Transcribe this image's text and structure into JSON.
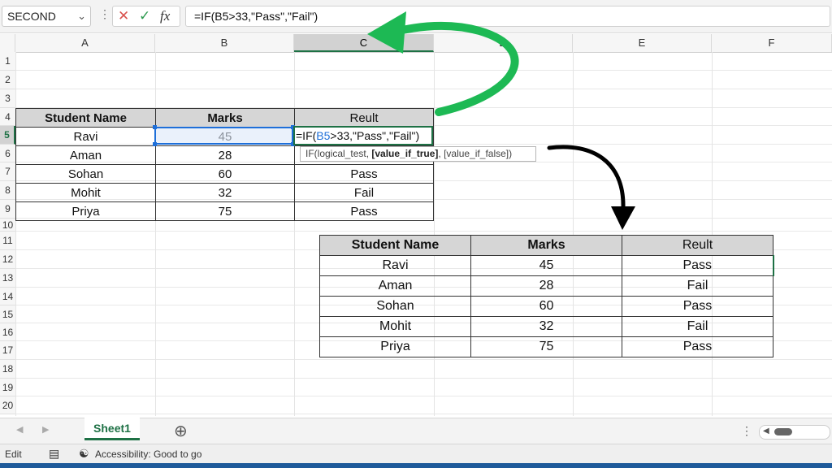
{
  "formula_bar": {
    "name_box": "SECOND",
    "dropdown_icon": "chevron-down-icon",
    "more_icon": "vertical-dots-icon",
    "cancel_icon": "✕",
    "enter_icon": "✓",
    "function_icon": "fx",
    "formula": "=IF(B5>33,\"Pass\",\"Fail\")"
  },
  "columns": [
    "A",
    "B",
    "C",
    "D",
    "E",
    "F"
  ],
  "rows": [
    "1",
    "2",
    "3",
    "4",
    "5",
    "6",
    "7",
    "8",
    "9",
    "10",
    "11",
    "12",
    "13",
    "14",
    "15",
    "16",
    "17",
    "18",
    "19",
    "20"
  ],
  "active_cell": {
    "edit_prefix": "=IF(",
    "edit_ref": "B5",
    "edit_suffix": ">33,\"Pass\",\"Fail\")"
  },
  "tooltip": {
    "open": "IF(logical_test, ",
    "bold": "[value_if_true]",
    "rest": ", [value_if_false])"
  },
  "table1": {
    "headers": [
      "Student Name",
      "Marks",
      "Reult"
    ],
    "rows": [
      [
        "Ravi",
        "45",
        ""
      ],
      [
        "Aman",
        "28",
        ""
      ],
      [
        "Sohan",
        "60",
        "Pass"
      ],
      [
        "Mohit",
        "32",
        "Fail"
      ],
      [
        "Priya",
        "75",
        "Pass"
      ]
    ]
  },
  "table2": {
    "headers": [
      "Student Name",
      "Marks",
      "Reult"
    ],
    "rows": [
      [
        "Ravi",
        "45",
        "Pass"
      ],
      [
        "Aman",
        "28",
        "Fail"
      ],
      [
        "Sohan",
        "60",
        "Pass"
      ],
      [
        "Mohit",
        "32",
        "Fail"
      ],
      [
        "Priya",
        "75",
        "Pass"
      ]
    ]
  },
  "sheet_tabs": {
    "active": "Sheet1",
    "add_icon": "plus-circle-icon"
  },
  "status_bar": {
    "mode": "Edit",
    "accessibility": "Accessibility: Good to go"
  },
  "colors": {
    "accent_green": "#1e7145",
    "arrow_green": "#1db954",
    "selection_blue": "#1e6fd9"
  }
}
